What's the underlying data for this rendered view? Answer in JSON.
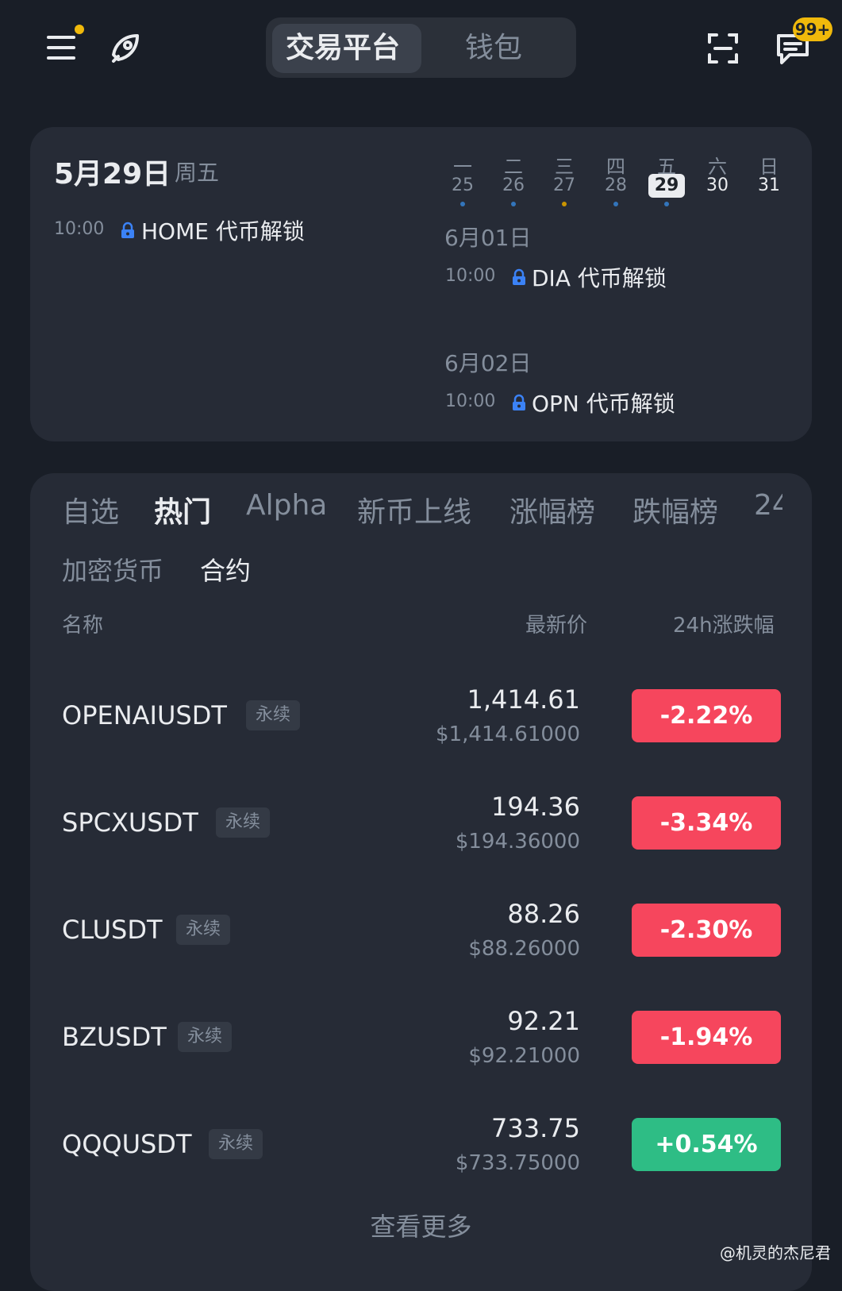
{
  "header": {
    "tabs": [
      {
        "label": "交易平台",
        "active": true
      },
      {
        "label": "钱包",
        "active": false
      }
    ],
    "message_badge": "99+",
    "icons": [
      "menu-icon",
      "rocket-icon",
      "scan-icon",
      "message-icon"
    ]
  },
  "calendar": {
    "date": "5月29日",
    "weekday": "周五",
    "week": [
      {
        "day": "一",
        "num": "25",
        "dot": "#3375bb"
      },
      {
        "day": "二",
        "num": "26",
        "dot": "#3375bb"
      },
      {
        "day": "三",
        "num": "27",
        "dot": "#c99400"
      },
      {
        "day": "四",
        "num": "28",
        "dot": "#3375bb"
      },
      {
        "day": "五",
        "num": "29",
        "dot": "#3375bb",
        "selected": true
      },
      {
        "day": "六",
        "num": "30"
      },
      {
        "day": "日",
        "num": "31"
      }
    ],
    "events": [
      {
        "time": "10:00",
        "label": "HOME 代币解锁"
      }
    ],
    "upcoming": [
      {
        "date": "6月01日",
        "time": "10:00",
        "label": "DIA 代币解锁"
      },
      {
        "date": "6月02日",
        "time": "10:00",
        "label": "OPN 代币解锁"
      }
    ]
  },
  "market": {
    "tabs": [
      "自选",
      "热门",
      "Alpha",
      "新币上线",
      "涨幅榜",
      "跌幅榜",
      "24"
    ],
    "active_tab": "热门",
    "subtabs": [
      "加密货币",
      "合约"
    ],
    "active_subtab": "合约",
    "columns": {
      "name": "名称",
      "price": "最新价",
      "change": "24h涨跌幅"
    },
    "rows": [
      {
        "symbol": "OPENAIUSDT",
        "tag": "永续",
        "price": "1,414.61",
        "usd": "$1,414.61000",
        "change": "-2.22%"
      },
      {
        "symbol": "SPCXUSDT",
        "tag": "永续",
        "price": "194.36",
        "usd": "$194.36000",
        "change": "-3.34%"
      },
      {
        "symbol": "CLUSDT",
        "tag": "永续",
        "price": "88.26",
        "usd": "$88.26000",
        "change": "-2.30%"
      },
      {
        "symbol": "BZUSDT",
        "tag": "永续",
        "price": "92.21",
        "usd": "$92.21000",
        "change": "-1.94%"
      },
      {
        "symbol": "QQQUSDT",
        "tag": "永续",
        "price": "733.75",
        "usd": "$733.75000",
        "change": "+0.54%"
      }
    ],
    "more": "查看更多"
  },
  "colors": {
    "down": "#f6465d",
    "up": "#2ebd85",
    "accent": "#f0b90b",
    "lock": "#3b82f6"
  },
  "watermark": "@机灵的杰尼君"
}
